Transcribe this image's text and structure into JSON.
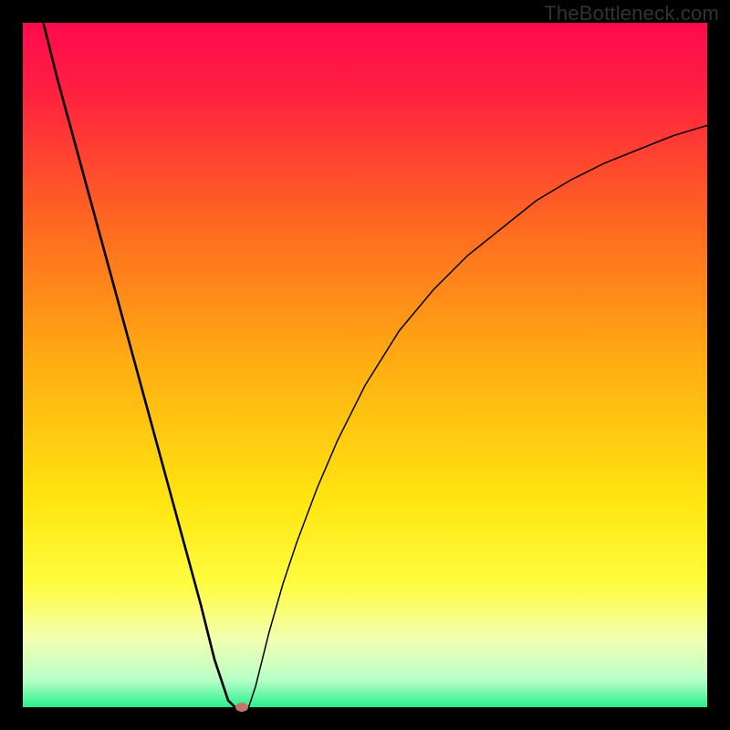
{
  "attribution": "TheBottleneck.com",
  "chart_data": {
    "type": "line",
    "title": "",
    "xlabel": "",
    "ylabel": "",
    "xlim": [
      0,
      100
    ],
    "ylim": [
      0,
      100
    ],
    "background": {
      "kind": "vertical_gradient",
      "stops": [
        {
          "t": 0.0,
          "color": "#ff0a4e"
        },
        {
          "t": 0.1,
          "color": "#ff2040"
        },
        {
          "t": 0.3,
          "color": "#ff6a20"
        },
        {
          "t": 0.5,
          "color": "#ffae12"
        },
        {
          "t": 0.7,
          "color": "#ffe610"
        },
        {
          "t": 0.82,
          "color": "#fffc40"
        },
        {
          "t": 0.9,
          "color": "#f3ffb0"
        },
        {
          "t": 0.96,
          "color": "#b8ffc8"
        },
        {
          "t": 1.0,
          "color": "#28f08c"
        }
      ]
    },
    "series": [
      {
        "name": "left_branch",
        "x": [
          3,
          5,
          8,
          11,
          14,
          17,
          20,
          23,
          26,
          28,
          30,
          31
        ],
        "y": [
          100,
          92,
          81,
          70,
          59,
          48,
          37,
          26,
          15,
          7,
          1,
          0
        ]
      },
      {
        "name": "right_branch",
        "x": [
          33,
          34,
          36,
          38,
          40,
          43,
          46,
          50,
          55,
          60,
          65,
          70,
          75,
          80,
          85,
          90,
          95,
          100
        ],
        "y": [
          0,
          3,
          11,
          18,
          24,
          32,
          39,
          47,
          55,
          61,
          66,
          70,
          74,
          77,
          79.5,
          81.5,
          83.5,
          85
        ]
      }
    ],
    "marker": {
      "x": 32,
      "y": 0,
      "color": "#c5736a"
    },
    "curve_stroke": "#000000",
    "curve_width": 2
  }
}
